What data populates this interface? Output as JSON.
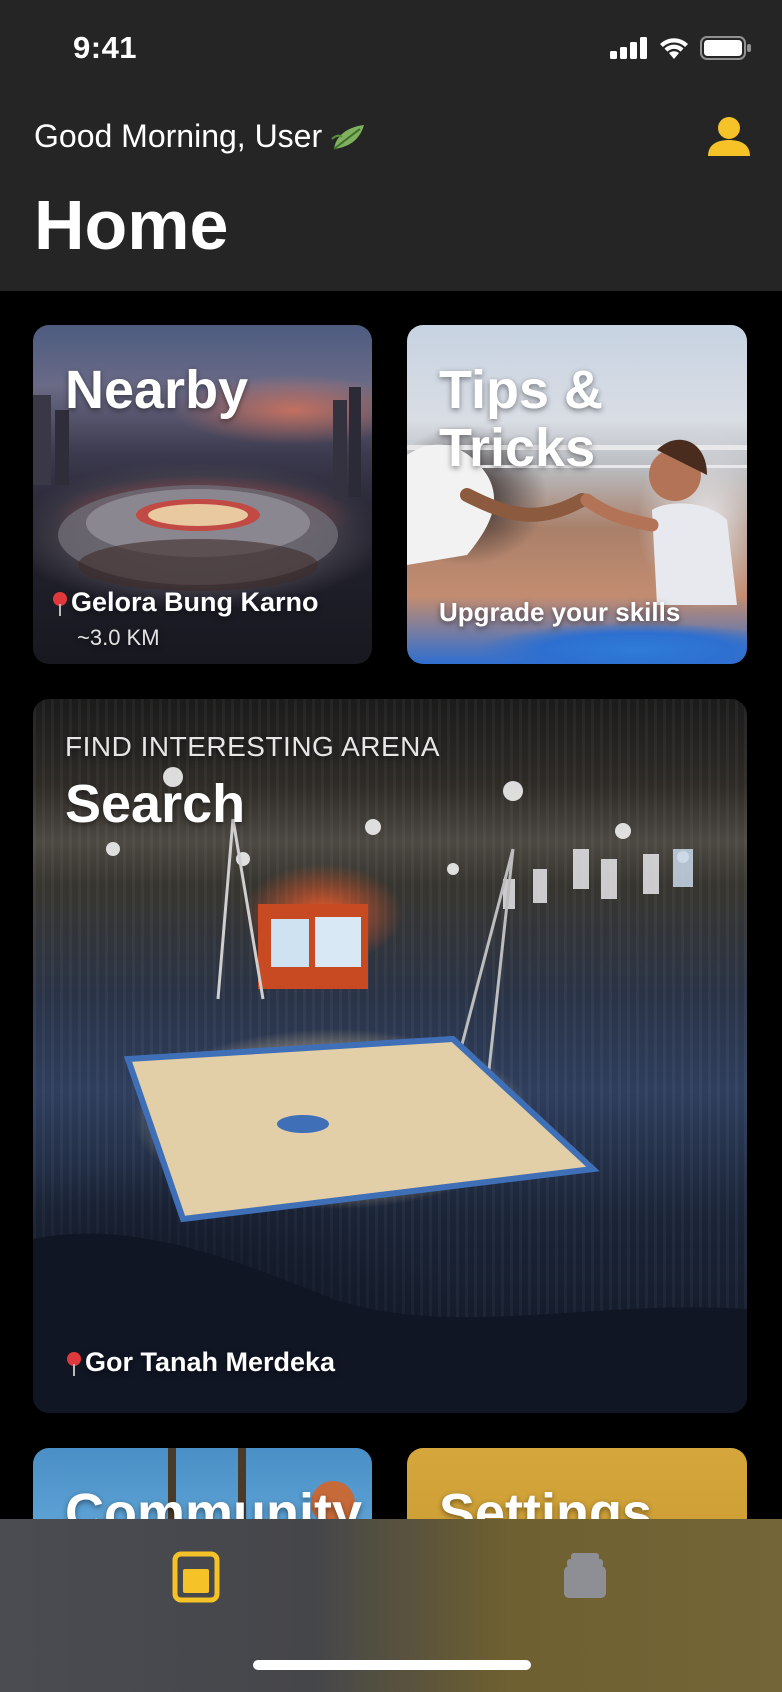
{
  "status_bar": {
    "time": "9:41"
  },
  "header": {
    "greeting": "Good Morning, User",
    "greeting_icon": "leaf-icon",
    "profile_icon": "user-icon",
    "title": "Home"
  },
  "cards": {
    "nearby": {
      "title": "Nearby",
      "location": "Gelora Bung Karno",
      "distance": "~3.0 KM",
      "location_icon": "pin-icon"
    },
    "tips": {
      "title_line1": "Tips &",
      "title_line2": "Tricks",
      "subtitle": "Upgrade your skills"
    },
    "search": {
      "overline": "FIND INTERESTING ARENA",
      "title": "Search",
      "location": "Gor Tanah Merdeka",
      "location_icon": "pin-icon"
    },
    "community": {
      "title": "Community"
    },
    "settings": {
      "title": "Settings"
    }
  },
  "tab_bar": {
    "tabs": [
      {
        "icon": "home-tab-icon",
        "active": true
      },
      {
        "icon": "stack-tab-icon",
        "active": false
      }
    ]
  },
  "colors": {
    "header_bg": "#252525",
    "page_bg": "#000000",
    "accent": "#f5c227",
    "inactive_tab": "#8d8f94"
  }
}
